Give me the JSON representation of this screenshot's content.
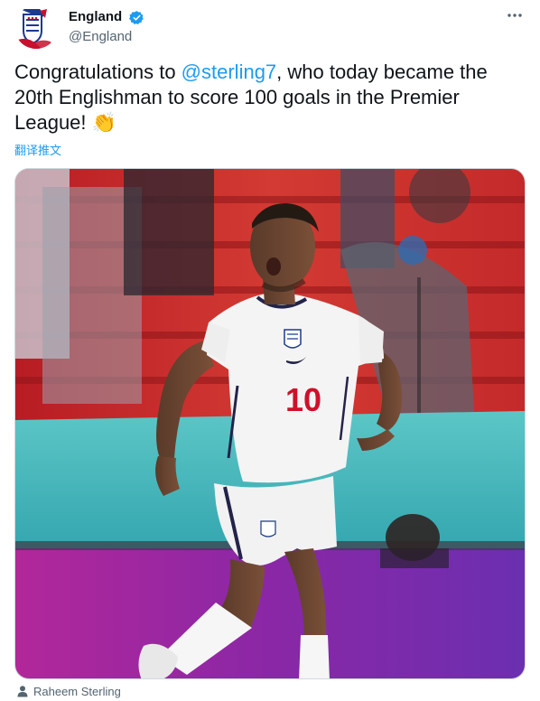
{
  "account": {
    "display_name": "England",
    "handle": "@England",
    "verified": true,
    "avatar_icon": "three-lions-crest-icon"
  },
  "tweet": {
    "text_before_mention": "Congratulations to ",
    "mention": "@sterling7",
    "text_after_mention": ", who today became the 20th Englishman to score 100 goals in the Premier League! ",
    "emoji": "👏",
    "translate_label": "翻译推文"
  },
  "media": {
    "type": "photo",
    "shirt_number": "10",
    "shirt_badge_text": "",
    "tagged_person": "Raheem Sterling"
  },
  "colors": {
    "link": "#1d9bf0",
    "text": "#0f1419",
    "secondary": "#536471",
    "verified_badge": "#1d9bf0",
    "shirt_number": "#d0102b"
  },
  "icons": {
    "more": "more-horizontal-icon",
    "verified": "verified-badge-icon",
    "tag": "person-icon"
  }
}
